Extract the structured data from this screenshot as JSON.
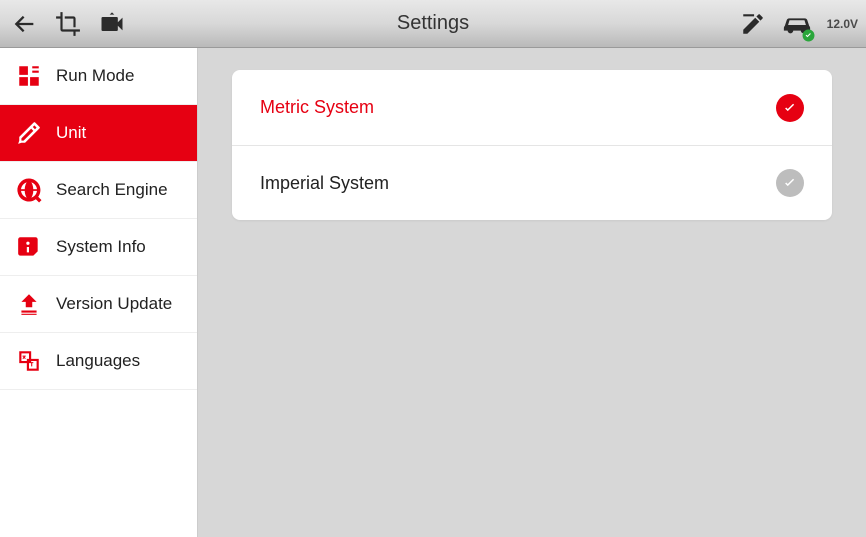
{
  "header": {
    "title": "Settings",
    "voltage": "12.0V"
  },
  "sidebar": {
    "items": [
      {
        "label": "Run Mode"
      },
      {
        "label": "Unit"
      },
      {
        "label": "Search Engine"
      },
      {
        "label": "System Info"
      },
      {
        "label": "Version Update"
      },
      {
        "label": "Languages"
      }
    ],
    "active_index": 1
  },
  "options": [
    {
      "label": "Metric System",
      "selected": true
    },
    {
      "label": "Imperial System",
      "selected": false
    }
  ],
  "colors": {
    "accent": "#e60012",
    "muted_check": "#bdbdbd"
  }
}
